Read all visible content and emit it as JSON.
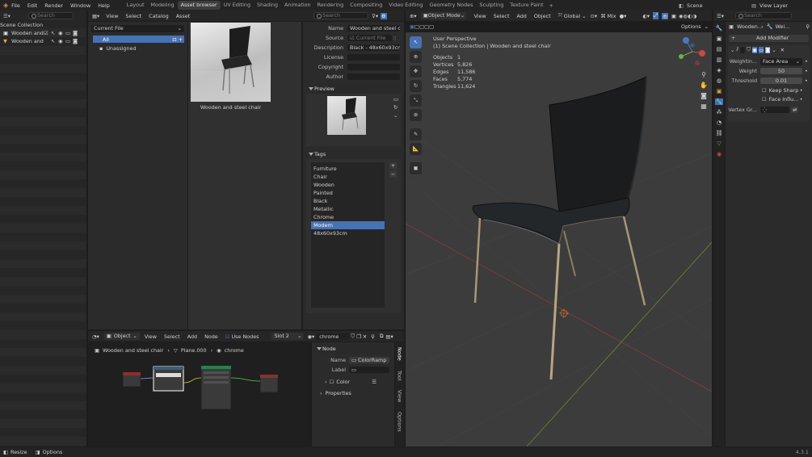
{
  "topbar": {
    "menus": [
      "File",
      "Edit",
      "Render",
      "Window",
      "Help"
    ],
    "workspaces": [
      "Layout",
      "Modeling",
      "Asset browser",
      "UV Editing",
      "Shading",
      "Animation",
      "Rendering",
      "Compositing",
      "Video Editing",
      "Geometry Nodes",
      "Sculpting",
      "Texture Paint"
    ],
    "active_workspace": "Asset browser",
    "scene": "Scene",
    "view_layer": "View Layer"
  },
  "outliner": {
    "title": "Scene Collection",
    "items": [
      "Wooden and",
      "Wooden and"
    ],
    "search_placeholder": "Search"
  },
  "asset_browser": {
    "menus": [
      "View",
      "Select",
      "Catalog",
      "Asset"
    ],
    "library": "Current File",
    "catalogs": [
      "All",
      "Unassigned"
    ],
    "search_placeholder": "Search",
    "asset_name": "Wooden and steel chair"
  },
  "asset_meta": {
    "fields": [
      {
        "label": "Name",
        "value": "Wooden and steel c..."
      },
      {
        "label": "Source",
        "value": "Current File"
      },
      {
        "label": "Description",
        "value": "Black - 48x60x93cm"
      },
      {
        "label": "License",
        "value": ""
      },
      {
        "label": "Copyright",
        "value": ""
      },
      {
        "label": "Author",
        "value": ""
      }
    ],
    "preview_title": "Preview",
    "tags_title": "Tags",
    "tags": [
      "Furniture",
      "Chair",
      "Wooden",
      "Painted",
      "Black",
      "Metallic",
      "Chrome",
      "Modern",
      "48x60x93cm"
    ],
    "selected_tag": "Modern"
  },
  "node_editor": {
    "editor_type": "Object",
    "menus": [
      "View",
      "Select",
      "Add",
      "Node"
    ],
    "use_nodes_label": "Use Nodes",
    "slot": "Slot 2",
    "material": "chrome",
    "breadcrumb": [
      "Wooden and steel chair",
      "Plane.000",
      "chrome"
    ],
    "node_panel": {
      "title": "Node",
      "name_label": "Name",
      "name_value": "ColorRamp",
      "label_label": "Label",
      "label_value": "",
      "color_label": "Color",
      "properties_label": "Properties"
    },
    "side_tabs": [
      "Node",
      "Tool",
      "View",
      "Options"
    ]
  },
  "viewport": {
    "mode": "Object Mode",
    "menus": [
      "View",
      "Select",
      "Add",
      "Object"
    ],
    "orientation": "Global",
    "pivot": "Mix",
    "options_label": "Options",
    "perspective": "User Perspective",
    "collection_path": "(1) Scene Collection | Wooden and steel chair",
    "stats": [
      {
        "label": "Objects",
        "value": "1"
      },
      {
        "label": "Vertices",
        "value": "5,826"
      },
      {
        "label": "Edges",
        "value": "11,586"
      },
      {
        "label": "Faces",
        "value": "5,774"
      },
      {
        "label": "Triangles",
        "value": "11,624"
      }
    ]
  },
  "properties": {
    "search_placeholder": "Search",
    "object": "Wooden...",
    "modifier_short": "Wei...",
    "add_modifier": "Add Modifier",
    "weighting_label": "Weightin...",
    "weighting_value": "Face Area",
    "weight_label": "Weight",
    "weight_value": "50",
    "threshold_label": "Threshold",
    "threshold_value": "0.01",
    "keep_sharp": "Keep Sharp",
    "face_influence": "Face Influ...",
    "vertex_group_label": "Vertex Gr..."
  },
  "statusbar": {
    "left_items": [
      "Resize",
      "Options"
    ],
    "version": "4.3.1"
  },
  "colors": {
    "accent": "#4772b3",
    "bg": "#1d1d1d",
    "viewport_bg": "#3a3a3a"
  }
}
